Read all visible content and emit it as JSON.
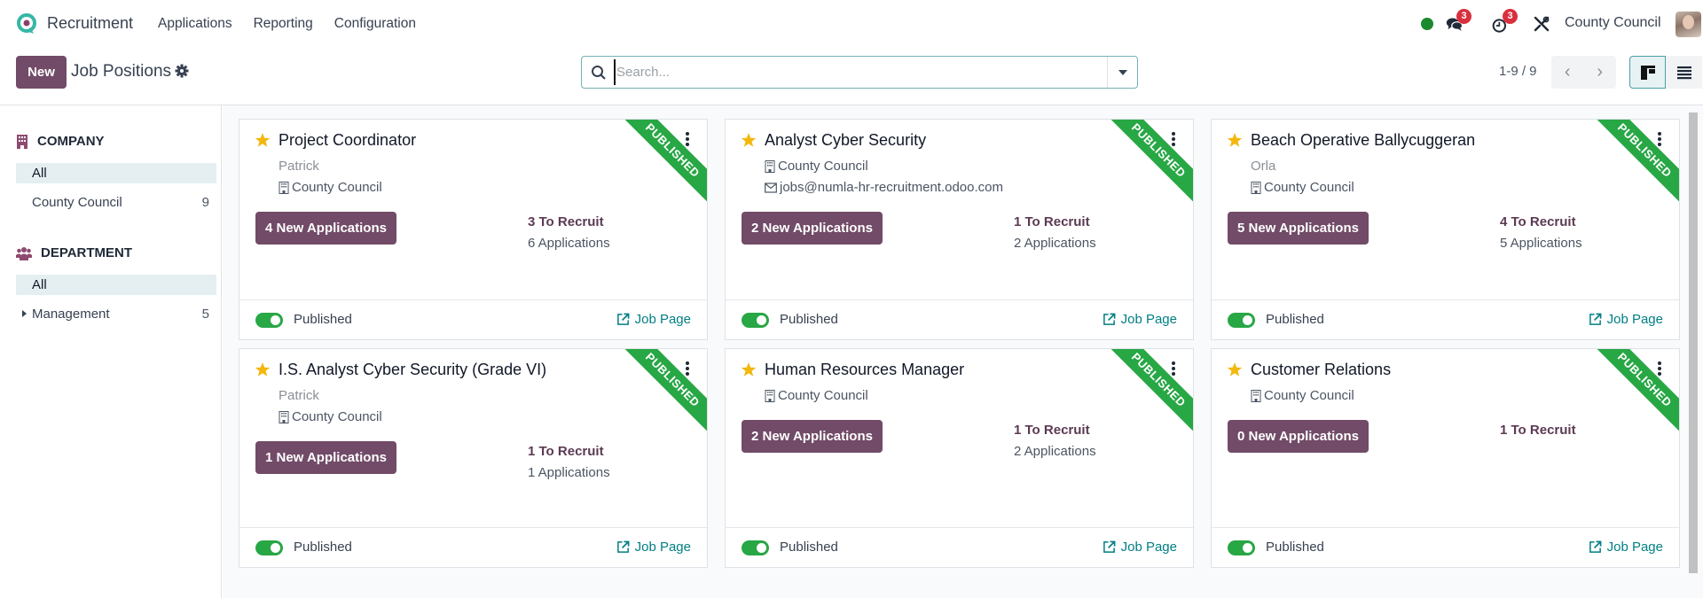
{
  "topnav": {
    "app_name": "Recruitment",
    "menu": [
      "Applications",
      "Reporting",
      "Configuration"
    ],
    "messages_badge": "3",
    "activities_badge": "3",
    "company": "County Council",
    "colors": {
      "brand": "#714b67",
      "presence": "#1b8a2e",
      "badge": "#d9303e"
    }
  },
  "control_panel": {
    "new_label": "New",
    "title": "Job Positions",
    "search_placeholder": "Search...",
    "search_value": "",
    "pager": "1-9 / 9",
    "views": [
      "kanban",
      "list"
    ],
    "active_view": "kanban"
  },
  "sidebar": {
    "company": {
      "header": "COMPANY",
      "items": [
        {
          "label": "All",
          "count": "",
          "active": true
        },
        {
          "label": "County Council",
          "count": "9",
          "active": false
        }
      ]
    },
    "department": {
      "header": "DEPARTMENT",
      "items": [
        {
          "label": "All",
          "count": "",
          "active": true
        },
        {
          "label": "Management",
          "count": "5",
          "active": false,
          "expandable": true
        }
      ]
    }
  },
  "cards": [
    {
      "title": "Project Coordinator",
      "user": "Patrick",
      "company": "County Council",
      "email": "",
      "new_applications": "4 New Applications",
      "to_recruit": "3 To Recruit",
      "applications": "6 Applications",
      "ribbon": "PUBLISHED",
      "published_label": "Published",
      "published": true,
      "job_page": "Job Page",
      "favorite": true
    },
    {
      "title": "Analyst Cyber Security",
      "user": "",
      "company": "County Council",
      "email": "jobs@numla-hr-recruitment.odoo.com",
      "new_applications": "2 New Applications",
      "to_recruit": "1 To Recruit",
      "applications": "2 Applications",
      "ribbon": "PUBLISHED",
      "published_label": "Published",
      "published": true,
      "job_page": "Job Page",
      "favorite": true
    },
    {
      "title": "Beach Operative Ballycuggeran",
      "user": "Orla",
      "company": "County Council",
      "email": "",
      "new_applications": "5 New Applications",
      "to_recruit": "4 To Recruit",
      "applications": "5 Applications",
      "ribbon": "PUBLISHED",
      "published_label": "Published",
      "published": true,
      "job_page": "Job Page",
      "favorite": true
    },
    {
      "title": "I.S. Analyst Cyber Security (Grade VI)",
      "user": "Patrick",
      "company": "County Council",
      "email": "",
      "new_applications": "1 New Applications",
      "to_recruit": "1 To Recruit",
      "applications": "1 Applications",
      "ribbon": "PUBLISHED",
      "published_label": "Published",
      "published": true,
      "job_page": "Job Page",
      "favorite": true
    },
    {
      "title": "Human Resources Manager",
      "user": "",
      "company": "County Council",
      "email": "",
      "new_applications": "2 New Applications",
      "to_recruit": "1 To Recruit",
      "applications": "2 Applications",
      "ribbon": "PUBLISHED",
      "published_label": "Published",
      "published": true,
      "job_page": "Job Page",
      "favorite": true
    },
    {
      "title": "Customer Relations",
      "user": "",
      "company": "County Council",
      "email": "",
      "new_applications": "0 New Applications",
      "to_recruit": "1 To Recruit",
      "applications": "",
      "ribbon": "PUBLISHED",
      "published_label": "Published",
      "published": true,
      "job_page": "Job Page",
      "favorite": true
    }
  ]
}
